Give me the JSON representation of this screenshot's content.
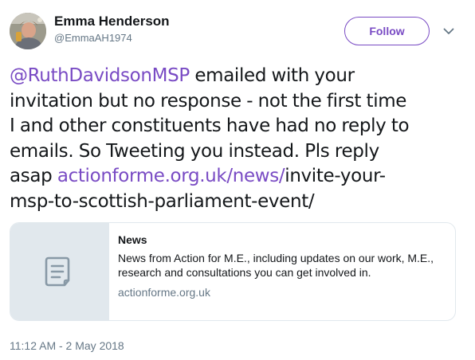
{
  "author": {
    "name": "Emma Henderson",
    "handle": "@EmmaAH1974",
    "avatar_icon": "profile-photo"
  },
  "header": {
    "follow_label": "Follow",
    "menu_icon": "chevron-down-icon"
  },
  "tweet": {
    "lines": [
      {
        "mention": "@RuthDavidsonMSP",
        "text": " emailed with your"
      },
      {
        "text": "invitation but no response - not the first time"
      },
      {
        "text": "I and other constituents have had no reply to"
      },
      {
        "text": "emails. So Tweeting you instead. Pls reply"
      },
      {
        "text": "asap ",
        "link": "actionforme.org.uk/news/",
        "text_after": "invite-your-"
      },
      {
        "text": "msp-to-scottish-parliament-event/"
      }
    ]
  },
  "card": {
    "title": "News",
    "description": "News from Action for M.E., including updates on our work, M.E., research and consultations you can get involved in.",
    "domain": "actionforme.org.uk",
    "thumb_icon": "document-icon"
  },
  "timestamp": "11:12 AM - 2 May 2018",
  "colors": {
    "accent": "#794bc4",
    "text": "#14171a",
    "secondary": "#657786",
    "border": "#e1e8ed"
  }
}
